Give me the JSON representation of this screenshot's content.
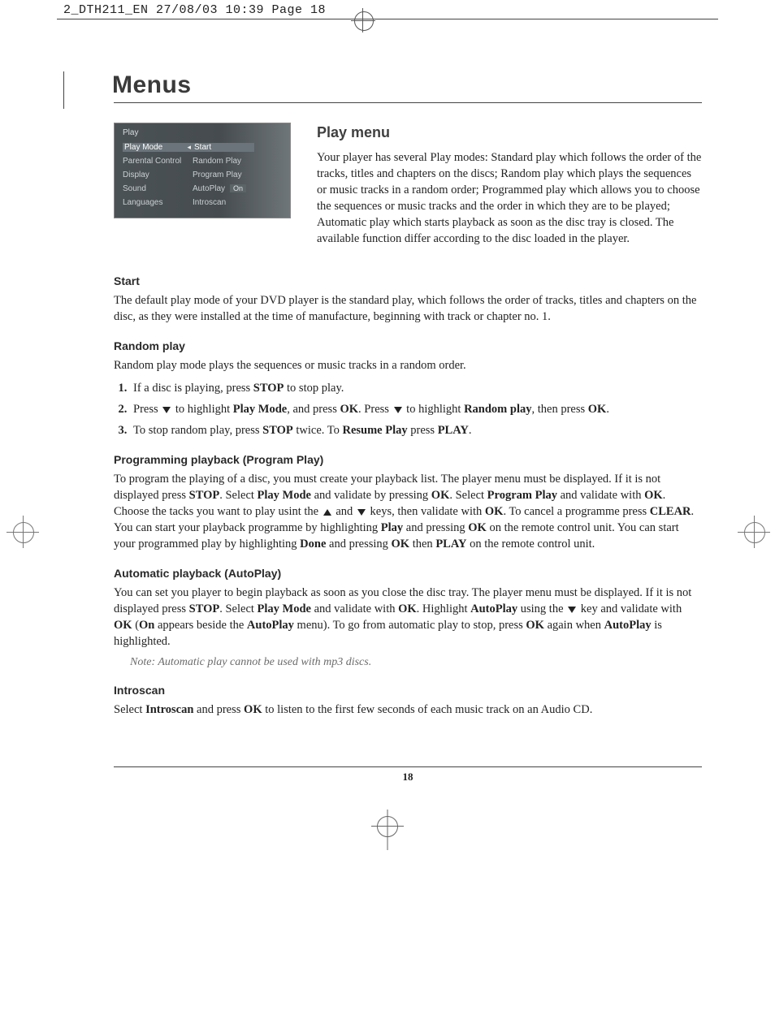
{
  "header": {
    "stamp": "2_DTH211_EN  27/08/03  10:39  Page 18"
  },
  "title": "Menus",
  "page_number": "18",
  "menu_screenshot": {
    "title": "Play",
    "left_items": [
      "Play Mode",
      "Parental Control",
      "Display",
      "Sound",
      "Languages"
    ],
    "right_items": [
      "Start",
      "Random Play",
      "Program Play",
      "AutoPlay",
      "Introscan"
    ],
    "autoplay_status": "On"
  },
  "sections": {
    "play_menu": {
      "heading": "Play menu",
      "body": "Your player has several Play modes: Standard play which follows the order of the tracks, titles and chapters on the discs; Random play which plays the sequences or music tracks in a random order; Programmed play which allows you to choose the sequences or music tracks and the order in which they are to be played; Automatic play which starts playback as soon as the disc tray is closed. The available function differ according to the disc loaded in the player."
    },
    "start": {
      "heading": "Start",
      "body": "The default play mode of your DVD player is the standard play, which follows the order of tracks, titles and chapters on the disc, as they were installed at the time of manufacture, beginning with track or chapter no. 1."
    },
    "random": {
      "heading": "Random play",
      "body": "Random play mode plays the sequences or music tracks in a random order.",
      "steps": {
        "s1_a": "If a disc is playing, press ",
        "s1_b": " to stop play.",
        "s2_a": "Press ",
        "s2_b": " to highlight ",
        "s2_c": ", and press ",
        "s2_d": ". Press ",
        "s2_e": " to highlight ",
        "s2_f": ", then press ",
        "s2_g": ".",
        "bold": {
          "stop": "STOP",
          "playmode": "Play Mode",
          "ok": "OK",
          "randomplay": "Random play"
        },
        "s3_a": "To stop random play, press ",
        "s3_b": " twice. To ",
        "s3_c": " press ",
        "s3_d": ".",
        "resume": "Resume Play",
        "play": "PLAY"
      }
    },
    "program": {
      "heading": "Programming playback (Program Play)",
      "t1": "To program the playing of a disc, you must create your playback list. The player menu must be displayed. If it is not displayed press ",
      "t2": ". Select ",
      "t3": " and validate by pressing ",
      "t4": ". Select ",
      "t5": " and validate with ",
      "t6": ". Choose the tacks you want to play usint the ",
      "t7": " and ",
      "t8": " keys, then validate with ",
      "t9": ". To cancel a programme press ",
      "t10": ". You can start your playback programme by highlighting ",
      "t11": " and pressing ",
      "t12": " on the remote control unit. You can start your programmed play by highlighting ",
      "t13": " and pressing ",
      "t14": " then ",
      "t15": " on the remote control unit.",
      "b": {
        "stop": "STOP",
        "playmode": "Play Mode",
        "ok": "OK",
        "programplay": "Program Play",
        "clear": "CLEAR",
        "play": "Play",
        "done": "Done",
        "PLAY": "PLAY"
      }
    },
    "autoplay": {
      "heading": "Automatic playback (AutoPlay)",
      "t1": "You can set you player to begin playback as soon as you close the disc tray. The player menu must be displayed. If it is not displayed press ",
      "t2": ". Select ",
      "t3": " and validate with ",
      "t4": ". Highlight ",
      "t5": " using the ",
      "t6": " key and validate with ",
      "t7": " (",
      "t8": " appears beside the ",
      "t9": " menu). To go from automatic play to stop, press ",
      "t10": " again when ",
      "t11": " is highlighted.",
      "b": {
        "stop": "STOP",
        "playmode": "Play Mode",
        "ok": "OK",
        "autoplay": "AutoPlay",
        "on": "On"
      },
      "note": "Note: Automatic play cannot be used with mp3 discs."
    },
    "introscan": {
      "heading": "Introscan",
      "t1": "Select ",
      "t2": " and press ",
      "t3": " to listen to the first few seconds of each music track on an Audio CD.",
      "b": {
        "introscan": "Introscan",
        "ok": "OK"
      }
    }
  }
}
